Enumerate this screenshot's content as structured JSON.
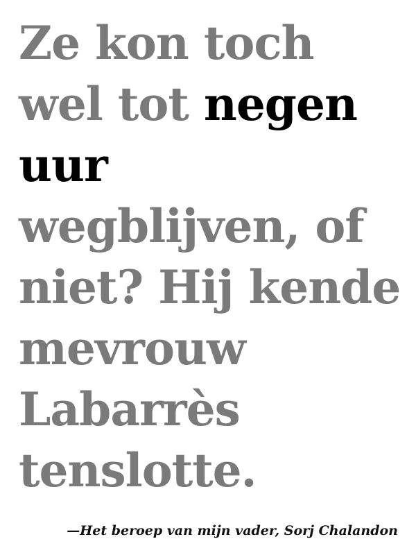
{
  "quote": {
    "line1": "Ze kon toch",
    "line2_pre": "wel tot ",
    "line2_emph": "negen",
    "line3_emph": "uur",
    "line4": "wegblijven, of",
    "line5": "niet? Hij kende",
    "line6": "mevrouw",
    "line7": "Labarrès",
    "line8": "tenslotte."
  },
  "attribution": "—Het beroep van mijn vader, Sorj Chalandon",
  "colors": {
    "text_muted": "#7a7a7a",
    "text_emphasis": "#000000",
    "background": "#ffffff"
  }
}
